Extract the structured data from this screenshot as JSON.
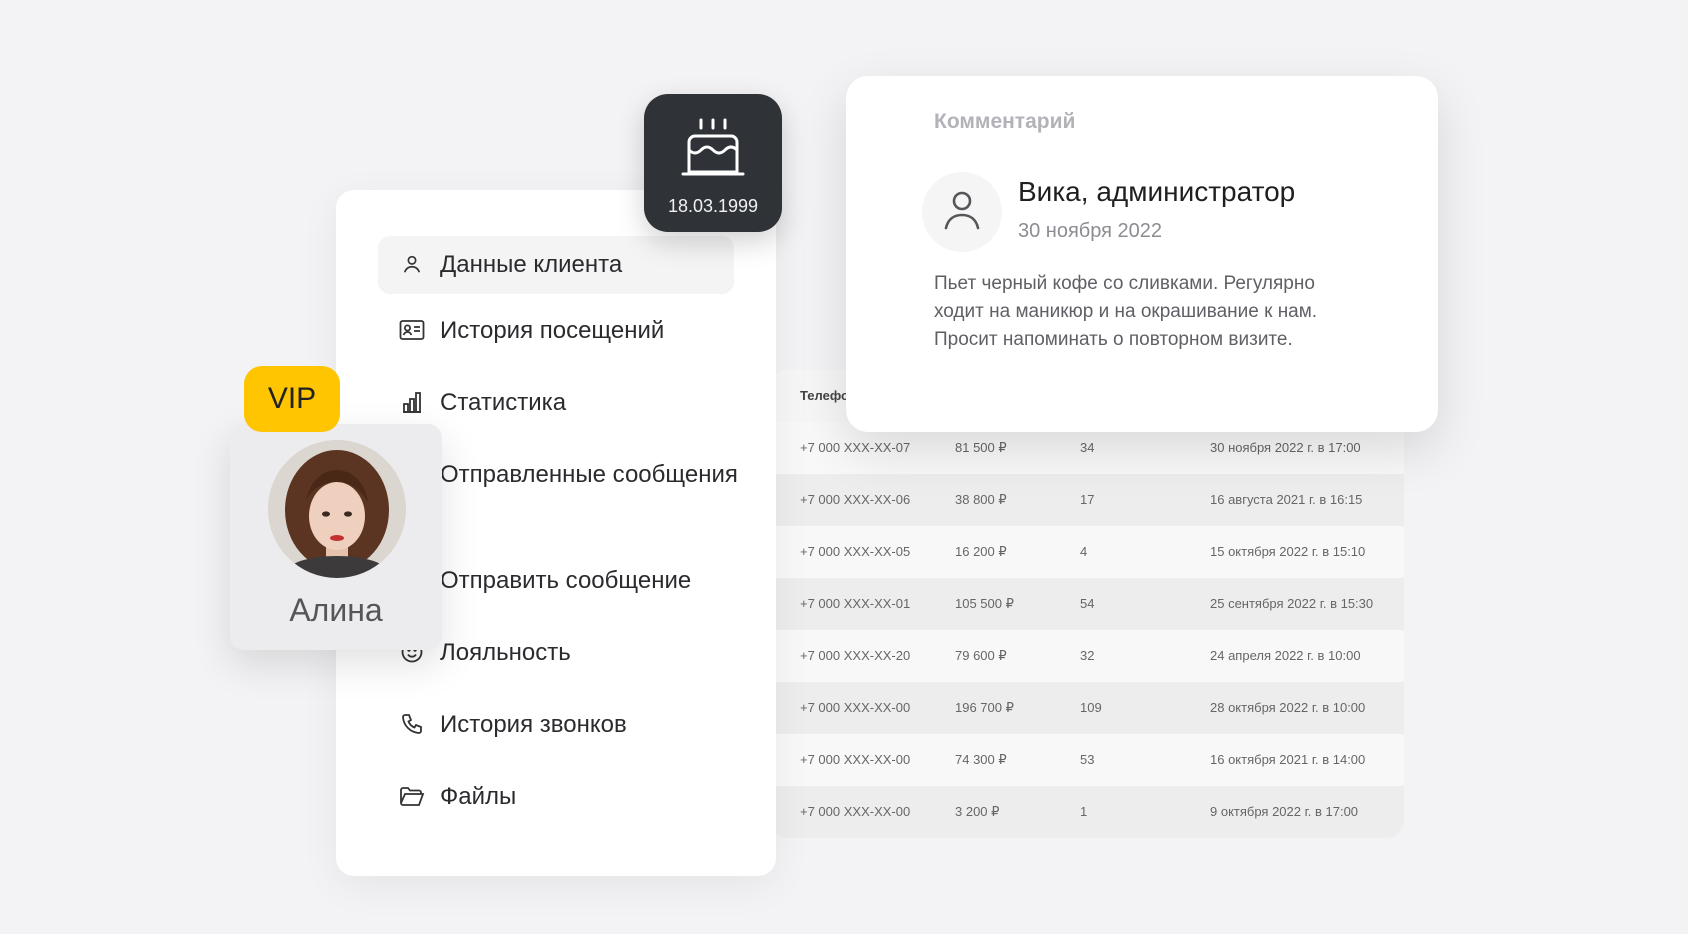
{
  "menu": {
    "items": [
      {
        "label": "Данные клиента",
        "icon": "user-icon",
        "active": true
      },
      {
        "label": "История посещений",
        "icon": "id-card-icon"
      },
      {
        "label": "Статистика",
        "icon": "bar-chart-icon"
      },
      {
        "label": "Отправленные сообщения",
        "icon": "sent-messages-icon"
      },
      {
        "label": "Отправить сообщение",
        "icon": "send-message-icon"
      },
      {
        "label": "Лояльность",
        "icon": "smile-icon"
      },
      {
        "label": "История звонков",
        "icon": "phone-icon"
      },
      {
        "label": "Файлы",
        "icon": "folder-icon"
      }
    ]
  },
  "birthday": {
    "date": "18.03.1999",
    "icon": "cake-icon"
  },
  "comment": {
    "heading": "Комментарий",
    "author": "Вика, администратор",
    "date": "30 ноября 2022",
    "text": "Пьет черный кофе со сливками. Регулярно ходит на маникюр и на окрашивание к нам. Просит напоминать о повторном визите."
  },
  "profile": {
    "badge": "VIP",
    "name": "Алина"
  },
  "table": {
    "header_phone": "Телефон",
    "rows": [
      {
        "phone": "+7 000 XXX-XX-07",
        "sum": "81 500 ₽",
        "visits": "34",
        "last": "30 ноября 2022 г. в 17:00"
      },
      {
        "phone": "+7 000 XXX-XX-06",
        "sum": "38 800 ₽",
        "visits": "17",
        "last": "16 августа 2021 г. в 16:15"
      },
      {
        "phone": "+7 000 XXX-XX-05",
        "sum": "16 200 ₽",
        "visits": "4",
        "last": "15 октября 2022 г. в 15:10"
      },
      {
        "phone": "+7 000 XXX-XX-01",
        "sum": "105 500 ₽",
        "visits": "54",
        "last": "25 сентября 2022 г. в 15:30"
      },
      {
        "phone": "+7 000 XXX-XX-20",
        "sum": "79 600 ₽",
        "visits": "32",
        "last": "24 апреля 2022 г. в 10:00"
      },
      {
        "phone": "+7 000 XXX-XX-00",
        "sum": "196 700 ₽",
        "visits": "109",
        "last": "28 октября 2022 г. в 10:00"
      },
      {
        "phone": "+7 000 XXX-XX-00",
        "sum": "74 300 ₽",
        "visits": "53",
        "last": "16 октября 2021 г. в 14:00"
      },
      {
        "phone": "+7 000 XXX-XX-00",
        "sum": "3 200 ₽",
        "visits": "1",
        "last": "9 октября 2022 г. в 17:00"
      }
    ]
  },
  "colors": {
    "vip": "#ffc500",
    "badge_dark": "#2f3338"
  }
}
